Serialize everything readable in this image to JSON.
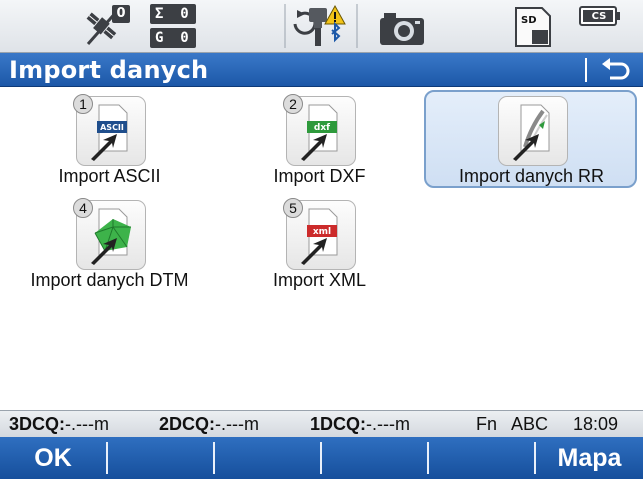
{
  "status": {
    "satellites": "0",
    "sum_counter": "Σ  0",
    "g_counter": "G  0",
    "battery_label": "CS",
    "sd_label": "SD"
  },
  "title": "Import danych",
  "tiles": [
    {
      "number": "1",
      "label": "Import ASCII",
      "icon": "ascii-file-icon",
      "badge": "ASCII"
    },
    {
      "number": "2",
      "label": "Import DXF",
      "icon": "dxf-file-icon",
      "badge": "dxf"
    },
    {
      "number": "",
      "label": "Import danych RR",
      "icon": "road-runner-icon",
      "selected": true
    },
    {
      "number": "4",
      "label": "Import danych DTM",
      "icon": "dtm-file-icon"
    },
    {
      "number": "5",
      "label": "Import XML",
      "icon": "xml-file-icon",
      "badge": "xml"
    }
  ],
  "info": {
    "q3_label": "3DCQ:",
    "q3_value": "-.---m",
    "q2_label": "2DCQ:",
    "q2_value": "-.---m",
    "q1_label": "1DCQ:",
    "q1_value": "-.---m",
    "fn": "Fn",
    "input_mode": "ABC",
    "time": "18:09"
  },
  "fkeys": {
    "f1": "OK",
    "f2": "",
    "f3": "",
    "f4": "",
    "f5": "",
    "f6": "Mapa"
  },
  "colors": {
    "accent": "#1c58a8",
    "selected_tile": "#cfdff3",
    "ascii_badge": "#1f4e8c",
    "dxf_badge": "#2e9a3c",
    "xml_badge": "#cc2b2b",
    "warning": "#f2c318"
  }
}
